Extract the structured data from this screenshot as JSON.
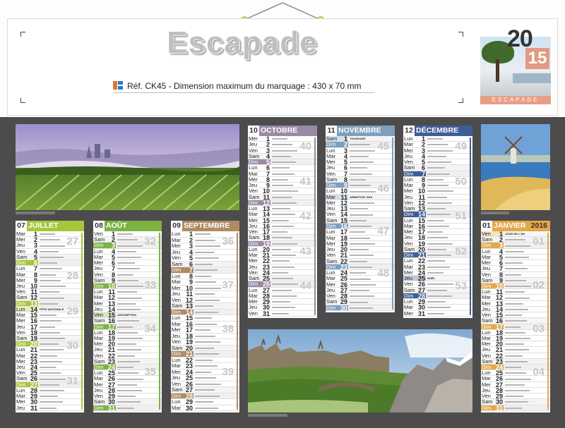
{
  "brand": "Escapade",
  "ref": "Réf. CK45 - Dimension maximum du marquage : 430 x 70 mm",
  "cover": {
    "year_a": "20",
    "year_b": "15",
    "label": "ESCAPADE"
  },
  "months": [
    {
      "id": "juillet",
      "num": "07",
      "name": "JUILLET",
      "year": "",
      "color": "#a7c73b",
      "days": [
        "Mar",
        "Mer",
        "Jeu",
        "Ven",
        "Sam",
        "Dim",
        "Lun",
        "Mar",
        "Mer",
        "Jeu",
        "Ven",
        "Sam",
        "Dim",
        "Lun",
        "Mar",
        "Mer",
        "Jeu",
        "Ven",
        "Sam",
        "Dim",
        "Lun",
        "Mar",
        "Mer",
        "Jeu",
        "Ven",
        "Sam",
        "Dim",
        "Lun",
        "Mar",
        "Mer",
        "Jeu"
      ],
      "start": 1,
      "highlights": [
        6,
        13,
        20,
        27
      ],
      "tint": [
        14
      ],
      "notes": {
        "14": "FÊTE NATIONALE"
      },
      "weeks": [
        "27",
        "28",
        "29",
        "30",
        "31"
      ]
    },
    {
      "id": "aout",
      "num": "08",
      "name": "AOÛT",
      "year": "",
      "color": "#7db343",
      "days": [
        "Ven",
        "Sam",
        "Dim",
        "Lun",
        "Mar",
        "Mer",
        "Jeu",
        "Ven",
        "Sam",
        "Dim",
        "Lun",
        "Mar",
        "Mer",
        "Jeu",
        "Ven",
        "Sam",
        "Dim",
        "Lun",
        "Mar",
        "Mer",
        "Jeu",
        "Ven",
        "Sam",
        "Dim",
        "Lun",
        "Mar",
        "Mer",
        "Jeu",
        "Ven",
        "Sam",
        "Dim"
      ],
      "start": 1,
      "highlights": [
        3,
        10,
        17,
        24,
        31
      ],
      "tint": [
        15
      ],
      "notes": {
        "15": "ASSOMPTION"
      },
      "weeks": [
        "32",
        "33",
        "34",
        "35"
      ]
    },
    {
      "id": "septembre",
      "num": "09",
      "name": "SEPTEMBRE",
      "year": "",
      "color": "#b08a61",
      "days": [
        "Lun",
        "Mar",
        "Mer",
        "Jeu",
        "Ven",
        "Sam",
        "Dim",
        "Lun",
        "Mar",
        "Mer",
        "Jeu",
        "Ven",
        "Sam",
        "Dim",
        "Lun",
        "Mar",
        "Mer",
        "Jeu",
        "Ven",
        "Sam",
        "Dim",
        "Lun",
        "Mar",
        "Mer",
        "Jeu",
        "Ven",
        "Sam",
        "Dim",
        "Lun",
        "Mar"
      ],
      "start": 1,
      "highlights": [
        7,
        14,
        21,
        28
      ],
      "tint": [],
      "notes": {},
      "weeks": [
        "36",
        "37",
        "38",
        "39"
      ]
    },
    {
      "id": "octobre",
      "num": "10",
      "name": "OCTOBRE",
      "year": "",
      "color": "#9b8aa6",
      "days": [
        "Mer",
        "Jeu",
        "Ven",
        "Sam",
        "Dim",
        "Lun",
        "Mar",
        "Mer",
        "Jeu",
        "Ven",
        "Sam",
        "Dim",
        "Lun",
        "Mar",
        "Mer",
        "Jeu",
        "Ven",
        "Sam",
        "Dim",
        "Lun",
        "Mar",
        "Mer",
        "Jeu",
        "Ven",
        "Sam",
        "Dim",
        "Lun",
        "Mar",
        "Mer",
        "Jeu",
        "Ven"
      ],
      "start": 1,
      "highlights": [
        5,
        12,
        19,
        26
      ],
      "tint": [],
      "notes": {},
      "weeks": [
        "40",
        "41",
        "42",
        "43",
        "44"
      ]
    },
    {
      "id": "novembre",
      "num": "11",
      "name": "NOVEMBRE",
      "year": "",
      "color": "#7e9fbd",
      "days": [
        "Sam",
        "Dim",
        "Lun",
        "Mar",
        "Mer",
        "Jeu",
        "Ven",
        "Sam",
        "Dim",
        "Lun",
        "Mar",
        "Mer",
        "Jeu",
        "Ven",
        "Sam",
        "Dim",
        "Lun",
        "Mar",
        "Mer",
        "Jeu",
        "Ven",
        "Sam",
        "Dim",
        "Lun",
        "Mar",
        "Mer",
        "Jeu",
        "Ven",
        "Sam",
        "Dim"
      ],
      "start": 1,
      "highlights": [
        2,
        9,
        16,
        23,
        30
      ],
      "tint": [
        1,
        11
      ],
      "notes": {
        "1": "TOUSSAINT",
        "11": "ARMISTICE 1918"
      },
      "weeks": [
        "45",
        "46",
        "47",
        "48"
      ]
    },
    {
      "id": "decembre",
      "num": "12",
      "name": "DÉCEMBRE",
      "year": "",
      "color": "#3f5d96",
      "days": [
        "Lun",
        "Mar",
        "Mer",
        "Jeu",
        "Ven",
        "Sam",
        "Dim",
        "Lun",
        "Mar",
        "Mer",
        "Jeu",
        "Ven",
        "Sam",
        "Dim",
        "Lun",
        "Mar",
        "Mer",
        "Jeu",
        "Ven",
        "Sam",
        "Dim",
        "Lun",
        "Mar",
        "Mer",
        "Jeu",
        "Ven",
        "Sam",
        "Dim",
        "Lun",
        "Mar",
        "Mer"
      ],
      "start": 1,
      "highlights": [
        7,
        14,
        21,
        28
      ],
      "tint": [
        25
      ],
      "notes": {
        "25": "NOËL"
      },
      "weeks": [
        "49",
        "50",
        "51",
        "52",
        "53"
      ]
    },
    {
      "id": "janvier",
      "num": "01",
      "name": "JANVIER",
      "year": "2016",
      "color": "#e4a84a",
      "days": [
        "Ven",
        "Sam",
        "Dim",
        "Lun",
        "Mar",
        "Mer",
        "Jeu",
        "Ven",
        "Sam",
        "Dim",
        "Lun",
        "Mar",
        "Mer",
        "Jeu",
        "Ven",
        "Sam",
        "Dim",
        "Lun",
        "Mar",
        "Mer",
        "Jeu",
        "Ven",
        "Sam",
        "Dim",
        "Lun",
        "Mar",
        "Mer",
        "Jeu",
        "Ven",
        "Sam",
        "Dim"
      ],
      "start": 1,
      "highlights": [
        3,
        10,
        17,
        24,
        31
      ],
      "tint": [
        1
      ],
      "notes": {
        "1": "JOUR DE L'AN"
      },
      "weeks": [
        "01",
        "02",
        "03",
        "04"
      ]
    }
  ]
}
